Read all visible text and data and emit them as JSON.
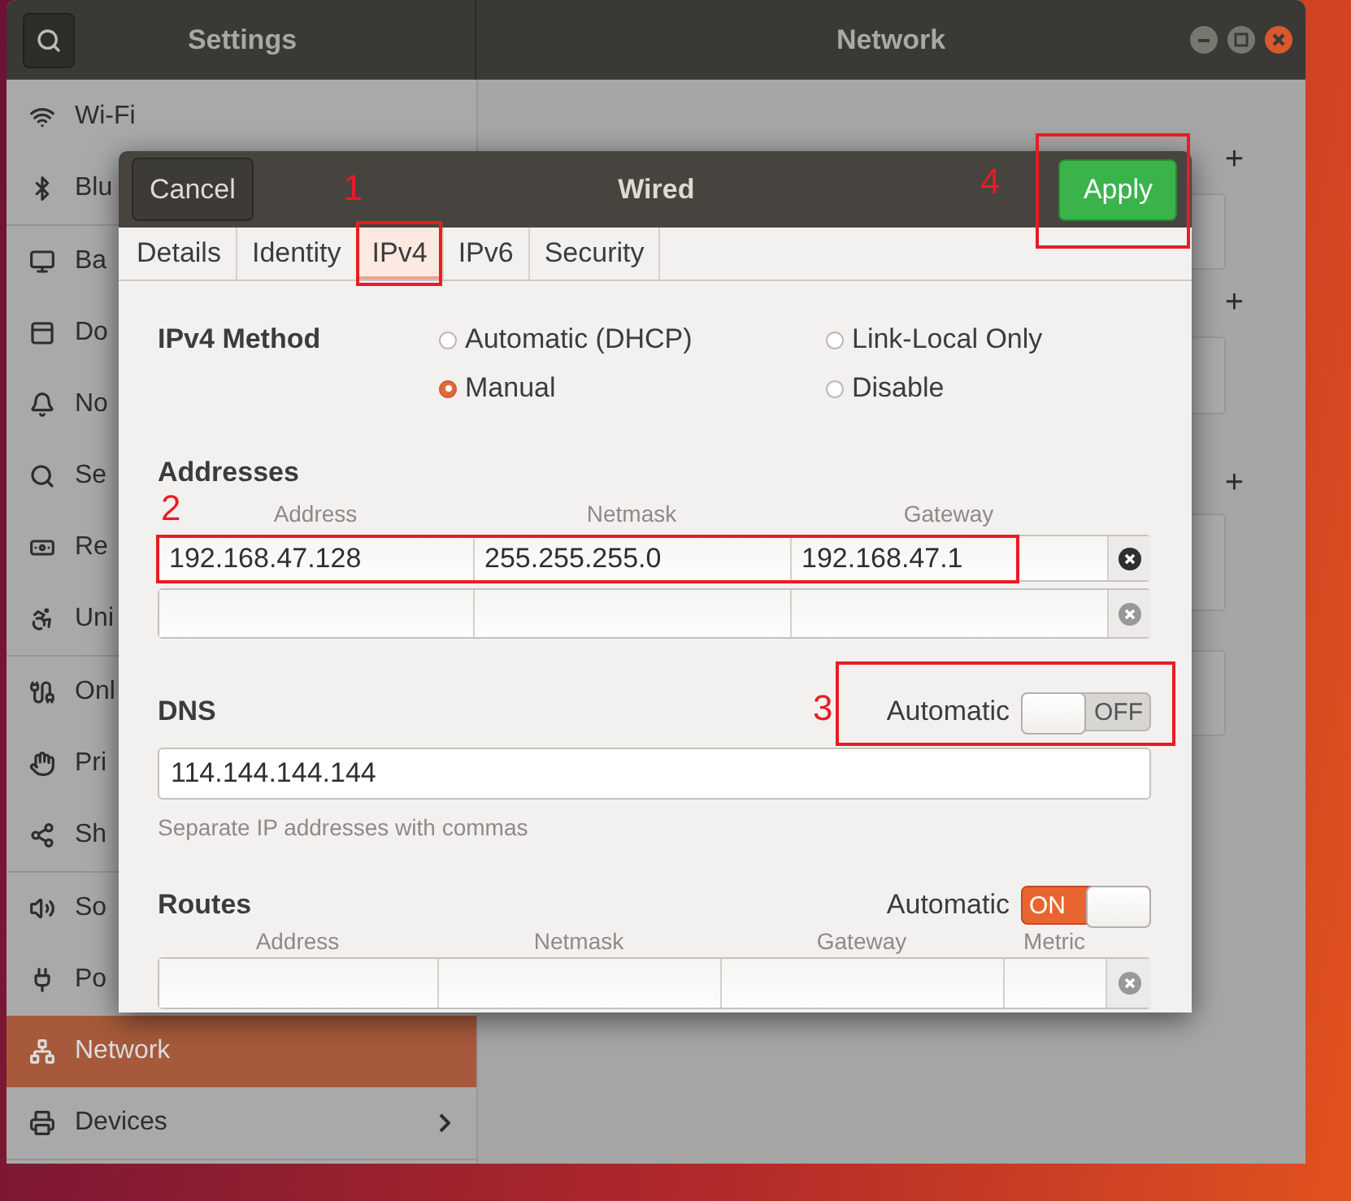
{
  "window": {
    "title": "Settings",
    "panel_title": "Network"
  },
  "sidebar": {
    "groups": [
      [
        {
          "label": "Wi-Fi",
          "selected": false,
          "has_submenu": false
        },
        {
          "label": "Blu",
          "selected": false,
          "has_submenu": false
        }
      ],
      [
        {
          "label": "Ba",
          "selected": false,
          "has_submenu": false
        },
        {
          "label": "Do",
          "selected": false,
          "has_submenu": false
        },
        {
          "label": "No",
          "selected": false,
          "has_submenu": false
        },
        {
          "label": "Se",
          "selected": false,
          "has_submenu": false
        },
        {
          "label": "Re",
          "selected": false,
          "has_submenu": false
        },
        {
          "label": "Uni",
          "selected": false,
          "has_submenu": false
        }
      ],
      [
        {
          "label": "Onl",
          "selected": false,
          "has_submenu": false
        },
        {
          "label": "Pri",
          "selected": false,
          "has_submenu": false
        },
        {
          "label": "Sh",
          "selected": false,
          "has_submenu": false
        }
      ],
      [
        {
          "label": "So",
          "selected": false,
          "has_submenu": false
        },
        {
          "label": "Po",
          "selected": false,
          "has_submenu": false
        },
        {
          "label": "Network",
          "selected": true,
          "has_submenu": false
        },
        {
          "label": "Devices",
          "selected": false,
          "has_submenu": true
        }
      ]
    ]
  },
  "main": {
    "add_buttons": [
      "+",
      "+",
      "+"
    ]
  },
  "dialog": {
    "title": "Wired",
    "cancel": "Cancel",
    "apply": "Apply",
    "tabs": [
      {
        "label": "Details",
        "selected": false
      },
      {
        "label": "Identity",
        "selected": false
      },
      {
        "label": "IPv4",
        "selected": true
      },
      {
        "label": "IPv6",
        "selected": false
      },
      {
        "label": "Security",
        "selected": false
      }
    ],
    "ipv4_method": {
      "label": "IPv4 Method",
      "options": [
        {
          "label": "Automatic (DHCP)",
          "selected": false
        },
        {
          "label": "Link-Local Only",
          "selected": false
        },
        {
          "label": "Manual",
          "selected": true
        },
        {
          "label": "Disable",
          "selected": false
        }
      ]
    },
    "addresses": {
      "heading": "Addresses",
      "columns": [
        "Address",
        "Netmask",
        "Gateway"
      ],
      "rows": [
        {
          "cells": [
            "192.168.47.128",
            "255.255.255.0",
            "192.168.47.1"
          ],
          "delete_disabled": false
        },
        {
          "delete_disabled": true
        }
      ]
    },
    "dns": {
      "heading": "DNS",
      "automatic_label": "Automatic",
      "automatic": {
        "on": false,
        "label": "OFF"
      },
      "value": "114.144.144.144",
      "hint": "Separate IP addresses with commas"
    },
    "routes": {
      "heading": "Routes",
      "automatic_label": "Automatic",
      "automatic": {
        "on": true,
        "label": "ON"
      },
      "columns": [
        "Address",
        "Netmask",
        "Gateway",
        "Metric"
      ],
      "rows": [
        {
          "delete_disabled": true
        }
      ]
    }
  },
  "annotations": [
    "1",
    "2",
    "3",
    "4"
  ]
}
